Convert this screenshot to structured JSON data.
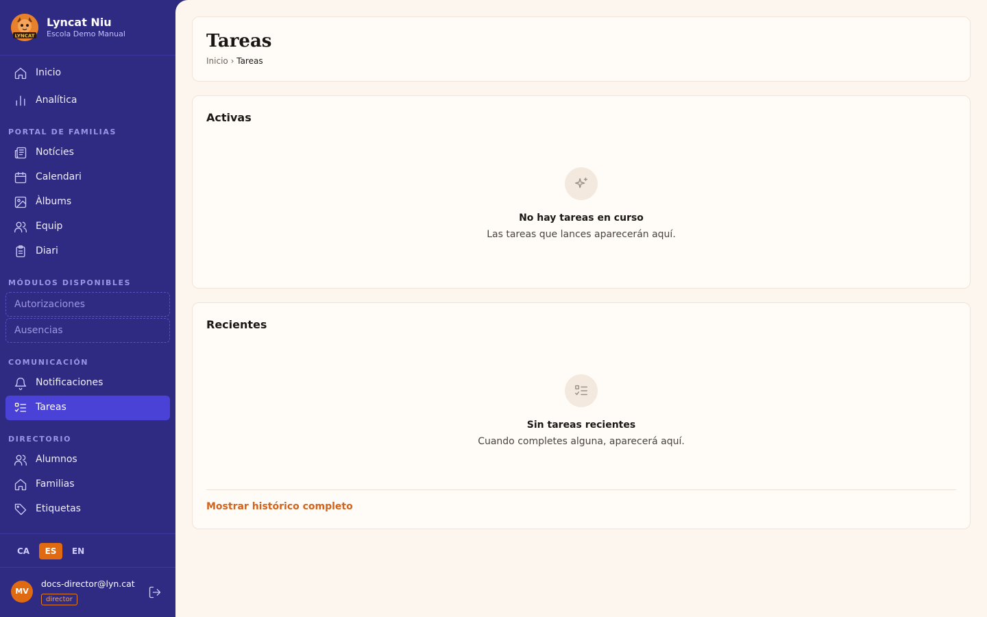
{
  "brand": {
    "name": "Lyncat Niu",
    "subtitle": "Escola Demo Manual",
    "logo_text": "LYNCAT"
  },
  "nav_top": [
    {
      "label": "Inicio",
      "icon": "home-icon"
    },
    {
      "label": "Analítica",
      "icon": "bar-chart-icon"
    }
  ],
  "sections": {
    "portal": "PORTAL DE FAMILIAS",
    "modules": "MÓDULOS DISPONIBLES",
    "communication": "COMUNICACIÓN",
    "directory": "DIRECTORIO"
  },
  "portal_items": [
    {
      "label": "Notícies",
      "icon": "newspaper-icon"
    },
    {
      "label": "Calendari",
      "icon": "calendar-icon"
    },
    {
      "label": "Àlbums",
      "icon": "image-icon"
    },
    {
      "label": "Equip",
      "icon": "users-icon"
    },
    {
      "label": "Diari",
      "icon": "clipboard-icon"
    }
  ],
  "module_items": [
    {
      "label": "Autorizaciones"
    },
    {
      "label": "Ausencias"
    }
  ],
  "communication_items": [
    {
      "label": "Notificaciones",
      "icon": "bell-icon"
    },
    {
      "label": "Tareas",
      "icon": "list-checks-icon",
      "active": true
    }
  ],
  "directory_items": [
    {
      "label": "Alumnos",
      "icon": "users-icon"
    },
    {
      "label": "Familias",
      "icon": "home-icon"
    },
    {
      "label": "Etiquetas",
      "icon": "tag-icon"
    }
  ],
  "languages": [
    {
      "code": "CA"
    },
    {
      "code": "ES",
      "active": true
    },
    {
      "code": "EN"
    }
  ],
  "user": {
    "initials": "MV",
    "email": "docs-director@lyn.cat",
    "role": "director"
  },
  "page": {
    "title": "Tareas",
    "breadcrumb_home": "Inicio",
    "breadcrumb_sep": "›",
    "breadcrumb_current": "Tareas"
  },
  "active_card": {
    "title": "Activas",
    "empty_icon": "sparkles-icon",
    "empty_title": "No hay tareas en curso",
    "empty_subtitle": "Las tareas que lances aparecerán aquí."
  },
  "recent_card": {
    "title": "Recientes",
    "empty_icon": "list-checks-icon",
    "empty_title": "Sin tareas recientes",
    "empty_subtitle": "Cuando completes alguna, aparecerá aquí.",
    "history_link": "Mostrar histórico completo"
  },
  "colors": {
    "sidebar": "#302b82",
    "active_nav": "#4a41d6",
    "accent": "#e06a12",
    "main_bg": "#fdf6ef"
  }
}
